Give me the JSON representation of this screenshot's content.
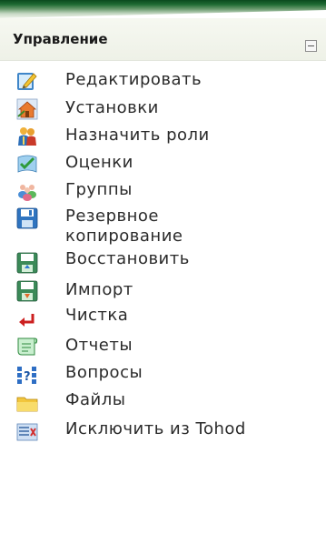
{
  "block": {
    "title": "Управление",
    "collapse_icon": "minus-square-icon"
  },
  "menu": {
    "items": [
      {
        "label": "Редактировать",
        "icon": "edit-pencil-icon"
      },
      {
        "label": "Установки",
        "icon": "settings-house-icon"
      },
      {
        "label": "Назначить роли",
        "icon": "assign-roles-icon"
      },
      {
        "label": "Оценки",
        "icon": "grades-icon"
      },
      {
        "label": "Группы",
        "icon": "groups-icon"
      },
      {
        "label_line1": "Резервное",
        "label_line2": "копирование",
        "icon": "backup-floppy-icon"
      },
      {
        "label": "Восстановить",
        "icon": "restore-icon"
      },
      {
        "label": "Импорт",
        "icon": "import-icon"
      },
      {
        "label": "Чистка",
        "icon": "reset-arrow-icon"
      },
      {
        "label": "Отчеты",
        "icon": "reports-icon"
      },
      {
        "label": "Вопросы",
        "icon": "questions-icon"
      },
      {
        "label": "Файлы",
        "icon": "files-folder-icon"
      },
      {
        "label": "Исключить из Tohod",
        "icon": "unenrol-icon"
      }
    ]
  },
  "colors": {
    "header_bg": "#eef1e7",
    "top_accent": "#1f6b33",
    "text": "#2a2a2a"
  }
}
